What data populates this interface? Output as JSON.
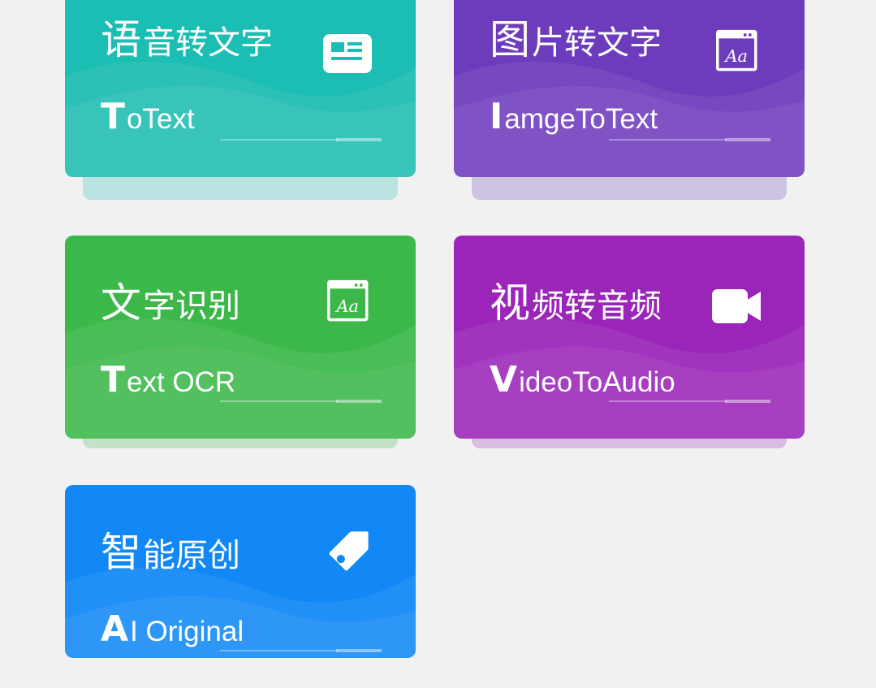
{
  "cards": [
    {
      "title_first": "语",
      "title_rest": "音转文字",
      "sub_first": "T",
      "sub_rest": "oText",
      "icon": "document-card-icon",
      "color": "#1cbdb2",
      "shadow": "#1cbdb2"
    },
    {
      "title_first": "图",
      "title_rest": "片转文字",
      "sub_first": "I",
      "sub_rest": "amgeToText",
      "icon": "font-window-icon",
      "color": "#6d3cbc",
      "shadow": "#6d3cbc"
    },
    {
      "title_first": "文",
      "title_rest": "字识别",
      "sub_first": "T",
      "sub_rest": "ext OCR",
      "icon": "font-window-icon",
      "color": "#3cb84a",
      "shadow": "#3cb84a"
    },
    {
      "title_first": "视",
      "title_rest": "频转音频",
      "sub_first": "V",
      "sub_rest": "ideoToAudio",
      "icon": "video-camera-icon",
      "color": "#9a25b8",
      "shadow": "#9a25b8"
    },
    {
      "title_first": "智",
      "title_rest": "能原创",
      "sub_first": "A",
      "sub_rest": "I Original",
      "icon": "tag-icon",
      "color": "#1188f6",
      "shadow": "#1188f6"
    }
  ]
}
